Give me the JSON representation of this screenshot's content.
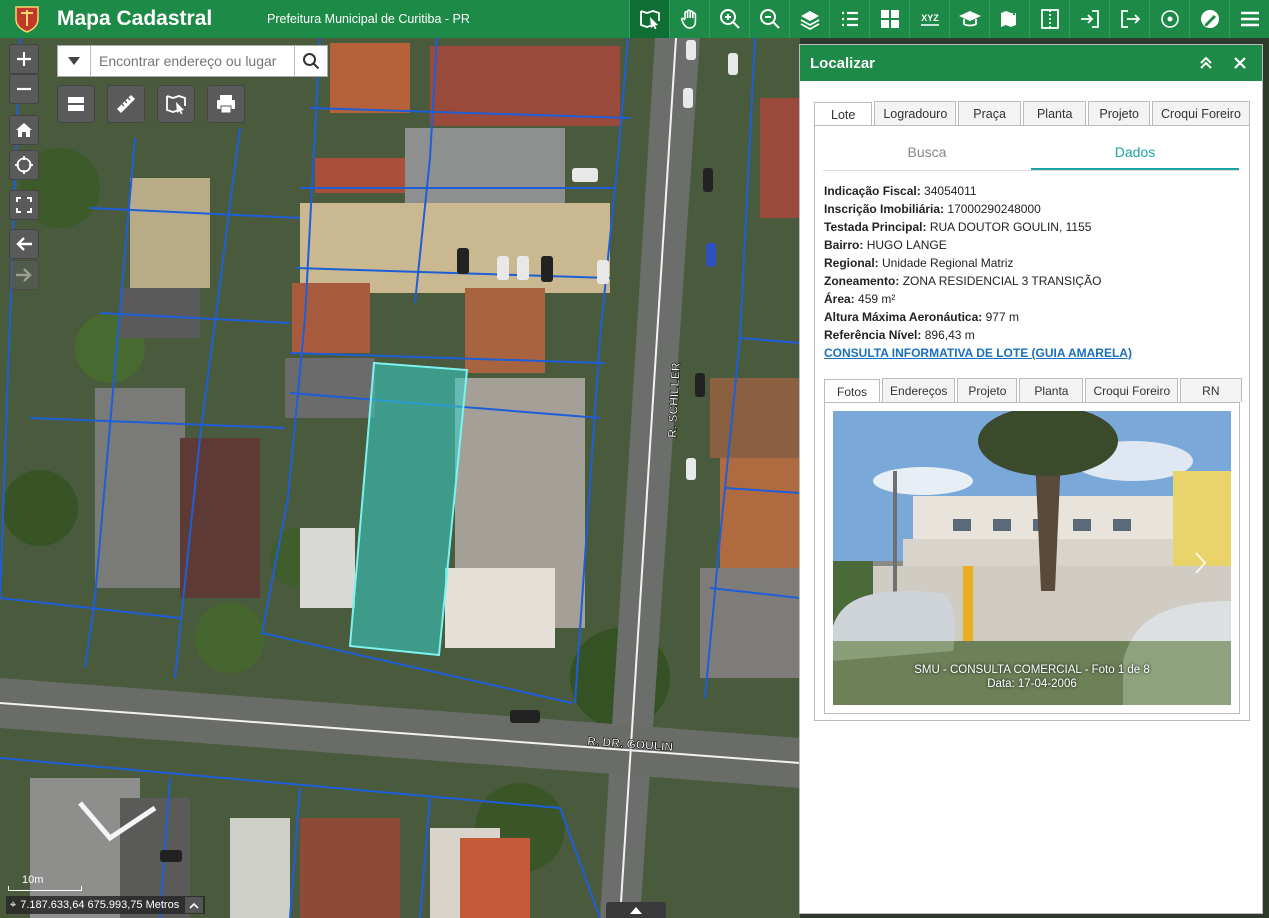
{
  "header": {
    "title": "Mapa Cadastral",
    "subtitle": "Prefeitura Municipal de Curitiba - PR",
    "tools": [
      {
        "icon": "identify-icon",
        "active": true
      },
      {
        "icon": "pan-hand-icon"
      },
      {
        "icon": "zoom-in-icon"
      },
      {
        "icon": "zoom-out-icon"
      },
      {
        "icon": "layers-add-icon"
      },
      {
        "icon": "list-icon"
      },
      {
        "icon": "grid-icon"
      },
      {
        "icon": "xyz-coordinate-icon",
        "label": "XYZ"
      },
      {
        "icon": "graduation-cap-icon"
      },
      {
        "icon": "map-pin-add-icon"
      },
      {
        "icon": "split-view-icon"
      },
      {
        "icon": "login-icon"
      },
      {
        "icon": "logout-icon"
      },
      {
        "icon": "target-icon"
      },
      {
        "icon": "globe-edit-icon"
      },
      {
        "icon": "menu-icon"
      }
    ]
  },
  "search": {
    "placeholder": "Encontrar endereço ou lugar"
  },
  "map": {
    "streets": [
      "R. SCHILLER",
      "R. DR. GOULIN"
    ],
    "scale_label": "10m",
    "coordinates": "7.187.633,64 675.993,75 Metros"
  },
  "panel": {
    "title": "Localizar",
    "tabs": [
      "Lote",
      "Logradouro",
      "Praça",
      "Planta",
      "Projeto",
      "Croqui Foreiro"
    ],
    "active_tab": "Lote",
    "subtabs": [
      "Busca",
      "Dados"
    ],
    "active_subtab": "Dados",
    "fields": [
      {
        "label": "Indicação Fiscal:",
        "value": "34054011"
      },
      {
        "label": "Inscrição Imobiliária:",
        "value": "17000290248000"
      },
      {
        "label": "Testada Principal:",
        "value": "RUA DOUTOR GOULIN, 1155"
      },
      {
        "label": "Bairro:",
        "value": "HUGO LANGE"
      },
      {
        "label": "Regional:",
        "value": "Unidade Regional Matriz"
      },
      {
        "label": "Zoneamento:",
        "value": "ZONA RESIDENCIAL 3 TRANSIÇÃO"
      },
      {
        "label": "Área:",
        "value": "459 m²"
      },
      {
        "label": "Altura Máxima Aeronáutica:",
        "value": "977 m"
      },
      {
        "label": "Referência Nível:",
        "value": "896,43 m"
      }
    ],
    "link": "CONSULTA INFORMATIVA DE LOTE (GUIA AMARELA)",
    "photo_tabs": [
      "Fotos",
      "Endereços",
      "Projeto",
      "Planta",
      "Croqui Foreiro",
      "RN"
    ],
    "active_photo_tab": "Fotos",
    "photo_caption_1": "SMU - CONSULTA COMERCIAL - Foto 1 de 8",
    "photo_caption_2": "Data: 17-04-2006"
  },
  "colors": {
    "header_green": "#1e8a47",
    "selected_lot": "#35d0c8",
    "parcel_lines": "#1e5ed8",
    "tab_accent": "#1aa3a3",
    "link": "#1a6fbf"
  }
}
